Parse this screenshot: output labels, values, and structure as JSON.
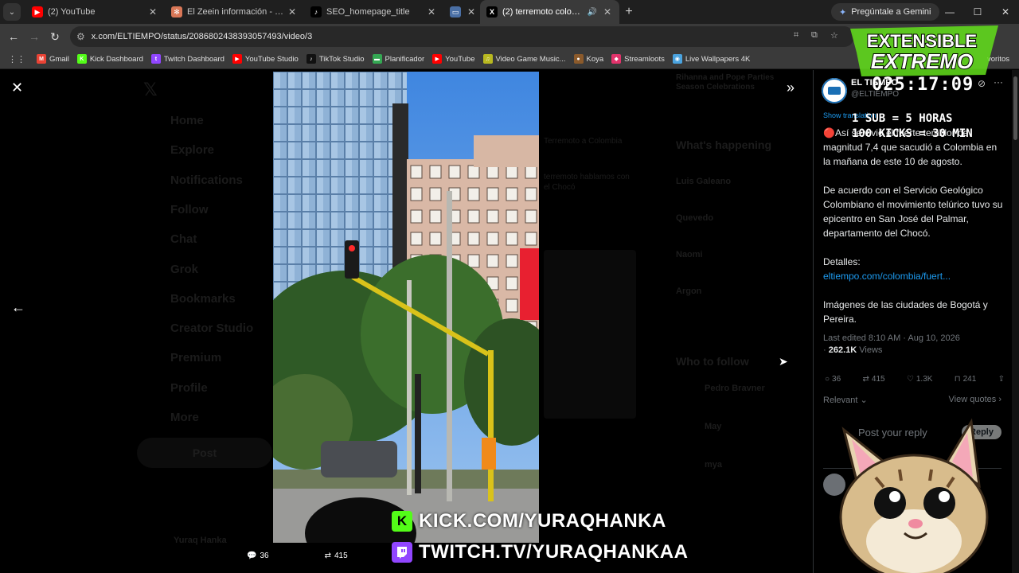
{
  "browser": {
    "tabs": [
      {
        "title": "(2) YouTube",
        "icon": "youtube-icon",
        "color": "#ff0000",
        "glyph": "▶"
      },
      {
        "title": "El Zeein información - Claude",
        "icon": "claude-icon",
        "color": "#d97757",
        "glyph": "✻"
      },
      {
        "title": "SEO_homepage_title",
        "icon": "tiktok-icon",
        "color": "#000000",
        "glyph": "♪"
      },
      {
        "title": "",
        "icon": "window-icon",
        "color": "#4a6fa5",
        "glyph": "▭"
      },
      {
        "title": "(2) terremoto colombia - Se",
        "icon": "x-icon",
        "color": "#000000",
        "glyph": "X",
        "active": true
      }
    ],
    "gemini_button": "Pregúntale a Gemini",
    "url": "x.com/ELTIEMPO/status/2086802438393057493/video/3",
    "bookmarks": [
      {
        "label": "Gmail",
        "color": "#ea4335",
        "glyph": "M"
      },
      {
        "label": "Kick Dashboard",
        "color": "#53fc18",
        "glyph": "K"
      },
      {
        "label": "Twitch Dashboard",
        "color": "#9146ff",
        "glyph": "t"
      },
      {
        "label": "YouTube Studio",
        "color": "#ff0000",
        "glyph": "▶"
      },
      {
        "label": "TikTok Studio",
        "color": "#111111",
        "glyph": "♪"
      },
      {
        "label": "Planificador",
        "color": "#34a853",
        "glyph": "▬"
      },
      {
        "label": "YouTube",
        "color": "#ff0000",
        "glyph": "▶"
      },
      {
        "label": "Video Game Music...",
        "color": "#b8b820",
        "glyph": "♫"
      },
      {
        "label": "Koya",
        "color": "#8b5a2b",
        "glyph": "●"
      },
      {
        "label": "Streamloots",
        "color": "#e2336b",
        "glyph": "◆"
      },
      {
        "label": "Live Wallpapers 4K",
        "color": "#4aa3df",
        "glyph": "◉"
      }
    ],
    "bookmarks_more": "voritos"
  },
  "background": {
    "nav": [
      "Home",
      "Explore",
      "Notifications",
      "Follow",
      "Chat",
      "Grok",
      "Bookmarks",
      "Creator Studio",
      "Premium",
      "Profile",
      "More"
    ],
    "post_button": "Post",
    "profile_name": "Yuraq Hanka",
    "whats_happening": "What's happening",
    "trends": [
      "Luis Galeano",
      "Quevedo",
      "Naomi",
      "Argon"
    ],
    "who_to_follow": "Who to follow",
    "follow_names": [
      "Pedro Bravner",
      "May",
      "mya"
    ],
    "top_snippet": "Rihanna and Pope Parties Season Celebrations",
    "mid_snippet1": "Terremoto a Colombia",
    "mid_snippet2": "terremoto hablamos con el Chocó"
  },
  "viewer": {
    "reply_count": "36",
    "repost_count": "415",
    "like_count": "1.3K"
  },
  "post": {
    "account_name": "EL TIEMPO",
    "account_handle": "@ELTIEMPO",
    "show_translation": "Show translation",
    "paragraph1": "🔴Así se vivió el fuerte temblor de magnitud 7,4 que sacudió a Colombia en la mañana de este 10 de agosto.",
    "paragraph2": "De acuerdo con el Servicio Geológico Colombiano el movimiento telúrico tuvo su epicentro en San José del Palmar, departamento del Chocó.",
    "details_label": "Detalles:",
    "details_link": "eltiempo.com/colombia/fuert...",
    "paragraph3": "Imágenes de las ciudades de Bogotá y Pereira.",
    "last_edited": "Last edited 8:10 AM · Aug 10, 2026",
    "views_count": "262.1K",
    "views_label": "Views",
    "replies": "36",
    "reposts": "415",
    "likes": "1.3K",
    "bookmarks": "241",
    "sort_label": "Relevant",
    "view_quotes": "View quotes",
    "reply_placeholder": "Post your reply",
    "reply_button": "Reply"
  },
  "overlay": {
    "logo_line1": "EXTENSIBLE",
    "logo_line2": "EXTREMO",
    "timer": "025:17:09",
    "sub_rule": "1 SUB = 5 HORAS",
    "kicks_rule": "100 KICKS = 30 MIN",
    "kick_url": "KICK.COM/YURAQHANKA",
    "twitch_url": "TWITCH.TV/YURAQHANKAA",
    "kick_glyph": "K",
    "brand_green": "#53fc18",
    "brand_purple": "#9146ff"
  }
}
